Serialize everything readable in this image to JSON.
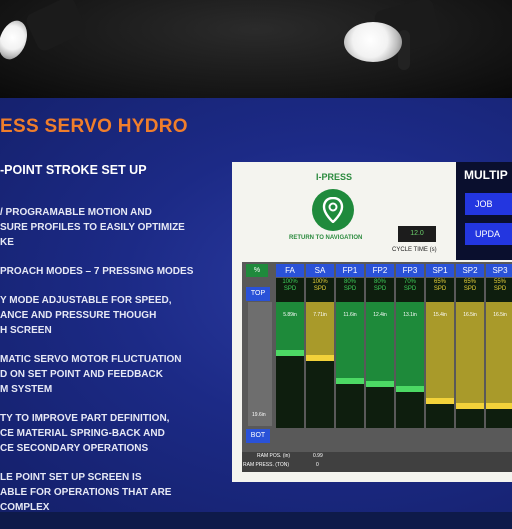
{
  "slide": {
    "title": "ESS SERVO HYDRO",
    "subtitle": "-POINT STROKE SET UP",
    "bullets": [
      "/ PROGRAMABLE MOTION AND\nSURE PROFILES TO EASILY OPTIMIZE\nKE",
      "PROACH MODES – 7 PRESSING MODES",
      "Y MODE ADJUSTABLE FOR SPEED,\nANCE AND PRESSURE THOUGH\nH SCREEN",
      "MATIC SERVO MOTOR FLUCTUATION\nD ON SET POINT AND FEEDBACK\nM SYSTEM",
      "TY TO IMPROVE PART DEFINITION,\nCE  MATERIAL SPRING-BACK AND\nCE SECONDARY OPERATIONS",
      "LE POINT SET UP SCREEN IS\nABLE FOR OPERATIONS THAT ARE\nCOMPLEX"
    ]
  },
  "hmi": {
    "brand": "I-PRESS",
    "nav_label": "RETURN TO NAVIGATION",
    "cycle_value": "12.0",
    "cycle_label": "CYCLE TIME (s)",
    "multi_title": "MULTIP",
    "buttons": [
      "JOB",
      "UPDA"
    ],
    "pct_label": "%",
    "top_label": "TOP",
    "bot_label": "BOT",
    "pos_label": "19.6in",
    "ram_pos_label": "RAM POS. (in)",
    "ram_pos_value": "0.99",
    "ram_press_label": "RAM PRESS. (TON)",
    "ram_press_value": "0",
    "columns": [
      {
        "name": "FA",
        "speed": "100%\nSPD",
        "value": "5.89in",
        "level": 0.62,
        "color": "green"
      },
      {
        "name": "SA",
        "speed": "100%\nSPD",
        "value": "7.71in",
        "level": 0.58,
        "color": "yellow"
      },
      {
        "name": "FP1",
        "speed": "80%\nSPD",
        "value": "11.6in",
        "level": 0.4,
        "color": "green"
      },
      {
        "name": "FP2",
        "speed": "80%\nSPD",
        "value": "12.4in",
        "level": 0.37,
        "color": "green"
      },
      {
        "name": "FP3",
        "speed": "70%\nSPD",
        "value": "13.1in",
        "level": 0.33,
        "color": "green"
      },
      {
        "name": "SP1",
        "speed": "65%\nSPD",
        "value": "15.4in",
        "level": 0.24,
        "color": "yellow"
      },
      {
        "name": "SP2",
        "speed": "65%\nSPD",
        "value": "16.5in",
        "level": 0.2,
        "color": "yellow"
      },
      {
        "name": "SP3",
        "speed": "55%\nSPD",
        "value": "16.5in",
        "level": 0.2,
        "color": "yellow"
      }
    ],
    "colors": {
      "green": "#1e8a3a",
      "green_marker": "#4cd964",
      "yellow": "#a99a2a",
      "yellow_marker": "#f2d23a"
    }
  }
}
